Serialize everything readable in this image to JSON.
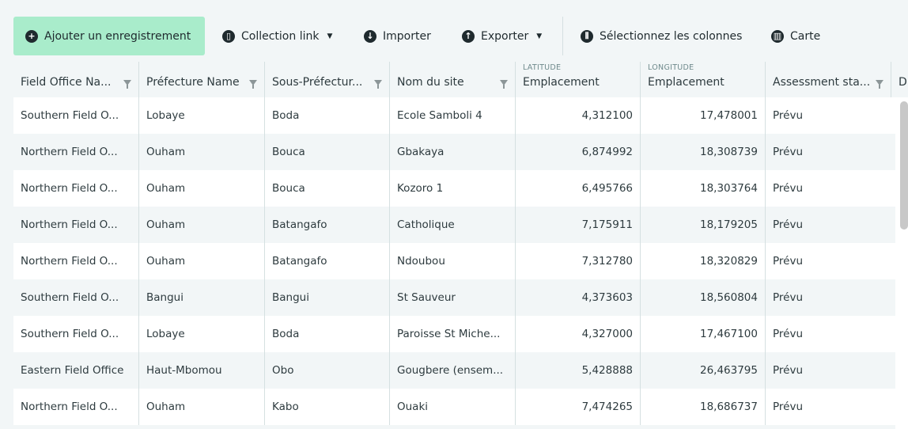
{
  "toolbar": {
    "add_record": "Ajouter un enregistrement",
    "collection_link": "Collection link",
    "import": "Importer",
    "export": "Exporter",
    "select_columns": "Sélectionnez les colonnes",
    "map": "Carte"
  },
  "columns": [
    {
      "label": "Field Office Na...",
      "filter": true
    },
    {
      "label": "Préfecture Name",
      "filter": true
    },
    {
      "label": "Sous-Préfectur...",
      "filter": true
    },
    {
      "label": "Nom du site",
      "filter": true
    },
    {
      "sub": "LATITUDE",
      "label": "Emplacement",
      "filter": false
    },
    {
      "sub": "LONGITUDE",
      "label": "Emplacement",
      "filter": false
    },
    {
      "label": "Assessment sta...",
      "filter": true
    },
    {
      "label": "D",
      "filter": false
    }
  ],
  "rows": [
    [
      "Southern Field O...",
      "Lobaye",
      "Boda",
      "Ecole Samboli 4",
      "4,312100",
      "17,478001",
      "Prévu"
    ],
    [
      "Northern Field O...",
      "Ouham",
      "Bouca",
      "Gbakaya",
      "6,874992",
      "18,308739",
      "Prévu"
    ],
    [
      "Northern Field O...",
      "Ouham",
      "Bouca",
      "Kozoro 1",
      "6,495766",
      "18,303764",
      "Prévu"
    ],
    [
      "Northern Field O...",
      "Ouham",
      "Batangafo",
      "Catholique",
      "7,175911",
      "18,179205",
      "Prévu"
    ],
    [
      "Northern Field O...",
      "Ouham",
      "Batangafo",
      "Ndoubou",
      "7,312780",
      "18,320829",
      "Prévu"
    ],
    [
      "Southern Field O...",
      "Bangui",
      "Bangui",
      "St Sauveur",
      "4,373603",
      "18,560804",
      "Prévu"
    ],
    [
      "Southern Field O...",
      "Lobaye",
      "Boda",
      "Paroisse St Miche...",
      "4,327000",
      "17,467100",
      "Prévu"
    ],
    [
      "Eastern Field Office",
      "Haut-Mbomou",
      "Obo",
      "Gougbere (ensem...",
      "5,428888",
      "26,463795",
      "Prévu"
    ],
    [
      "Northern Field O...",
      "Ouham",
      "Kabo",
      "Ouaki",
      "7,474265",
      "18,686737",
      "Prévu"
    ]
  ]
}
